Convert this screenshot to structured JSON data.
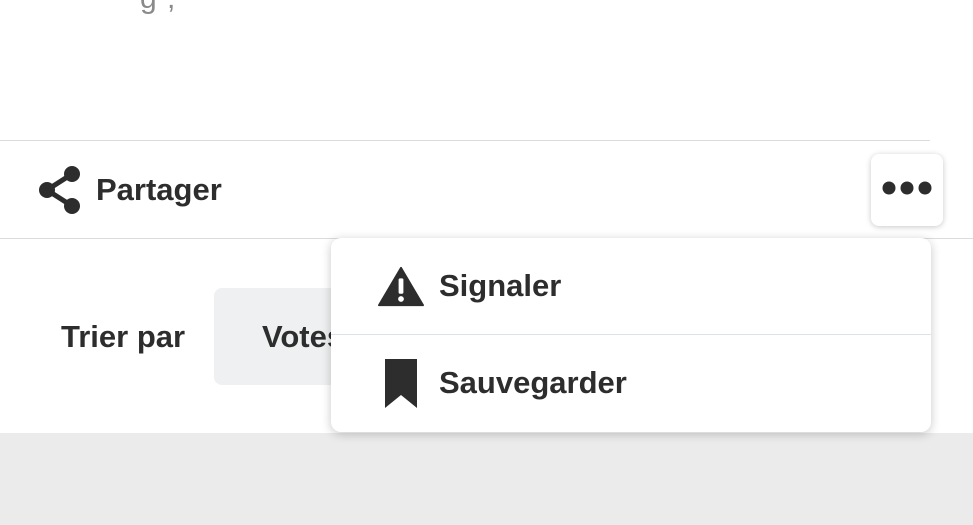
{
  "header": {
    "partial_text": "g ,"
  },
  "actions": {
    "share_label": "Partager",
    "share_icon": "share-icon",
    "more_icon": "more-horizontal-icon"
  },
  "sort": {
    "label": "Trier par",
    "selected_value": "Votes"
  },
  "menu": {
    "items": [
      {
        "label": "Signaler",
        "icon": "warning-icon"
      },
      {
        "label": "Sauvegarder",
        "icon": "bookmark-icon"
      }
    ]
  },
  "colors": {
    "text": "#2d2d2d",
    "divider": "#dcdcdc",
    "select_bg": "#eef0f1",
    "footer_bg": "#ebebeb"
  }
}
